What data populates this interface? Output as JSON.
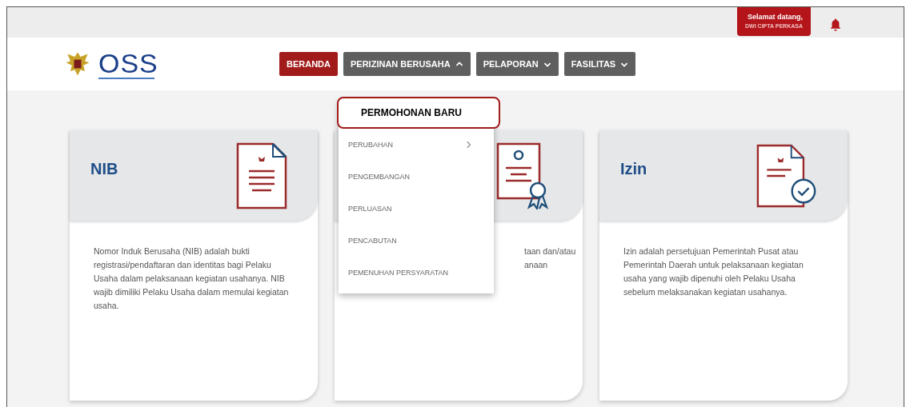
{
  "header": {
    "welcome": "Selamat datang,",
    "user": "DWI CIPTA PERKASA"
  },
  "logo": {
    "text": "OSS"
  },
  "nav": [
    {
      "label": "BERANDA",
      "selected": true,
      "kind": "link"
    },
    {
      "label": "PERIZINAN BERUSAHA",
      "selected": false,
      "kind": "dropdown",
      "expanded": true
    },
    {
      "label": "PELAPORAN",
      "selected": false,
      "kind": "dropdown",
      "expanded": false
    },
    {
      "label": "FASILITAS",
      "selected": false,
      "kind": "dropdown",
      "expanded": false
    }
  ],
  "dropdown": [
    {
      "label": "PERMOHONAN BARU",
      "selected": true,
      "submenu": false
    },
    {
      "label": "PERUBAHAN",
      "selected": false,
      "submenu": true
    },
    {
      "label": "PENGEMBANGAN",
      "selected": false,
      "submenu": false
    },
    {
      "label": "PERLUASAN",
      "selected": false,
      "submenu": false
    },
    {
      "label": "PENCABUTAN",
      "selected": false,
      "submenu": false
    },
    {
      "label": "PEMENUHAN PERSYARATAN",
      "selected": false,
      "submenu": false
    }
  ],
  "cards": [
    {
      "title": "NIB",
      "text": [
        "Nomor Induk Berusaha (NIB) adalah bukti registrasi/pendaftaran dan identitas bagi Pelaku Usaha dalam pelaksanaan kegiatan usahanya. NIB wajib dimiliki Pelaku Usaha dalam memulai kegiatan usaha."
      ]
    },
    {
      "text": [
        "taan dan/atau",
        "anaan"
      ]
    },
    {
      "title": "Izin",
      "text": [
        "Izin adalah persetujuan Pemerintah Pusat atau Pemerintah Daerah untuk pelaksanaan kegiatan usaha yang wajib dipenuhi oleh Pelaku Usaha sebelum melaksanakan kegiatan usahanya."
      ]
    }
  ]
}
